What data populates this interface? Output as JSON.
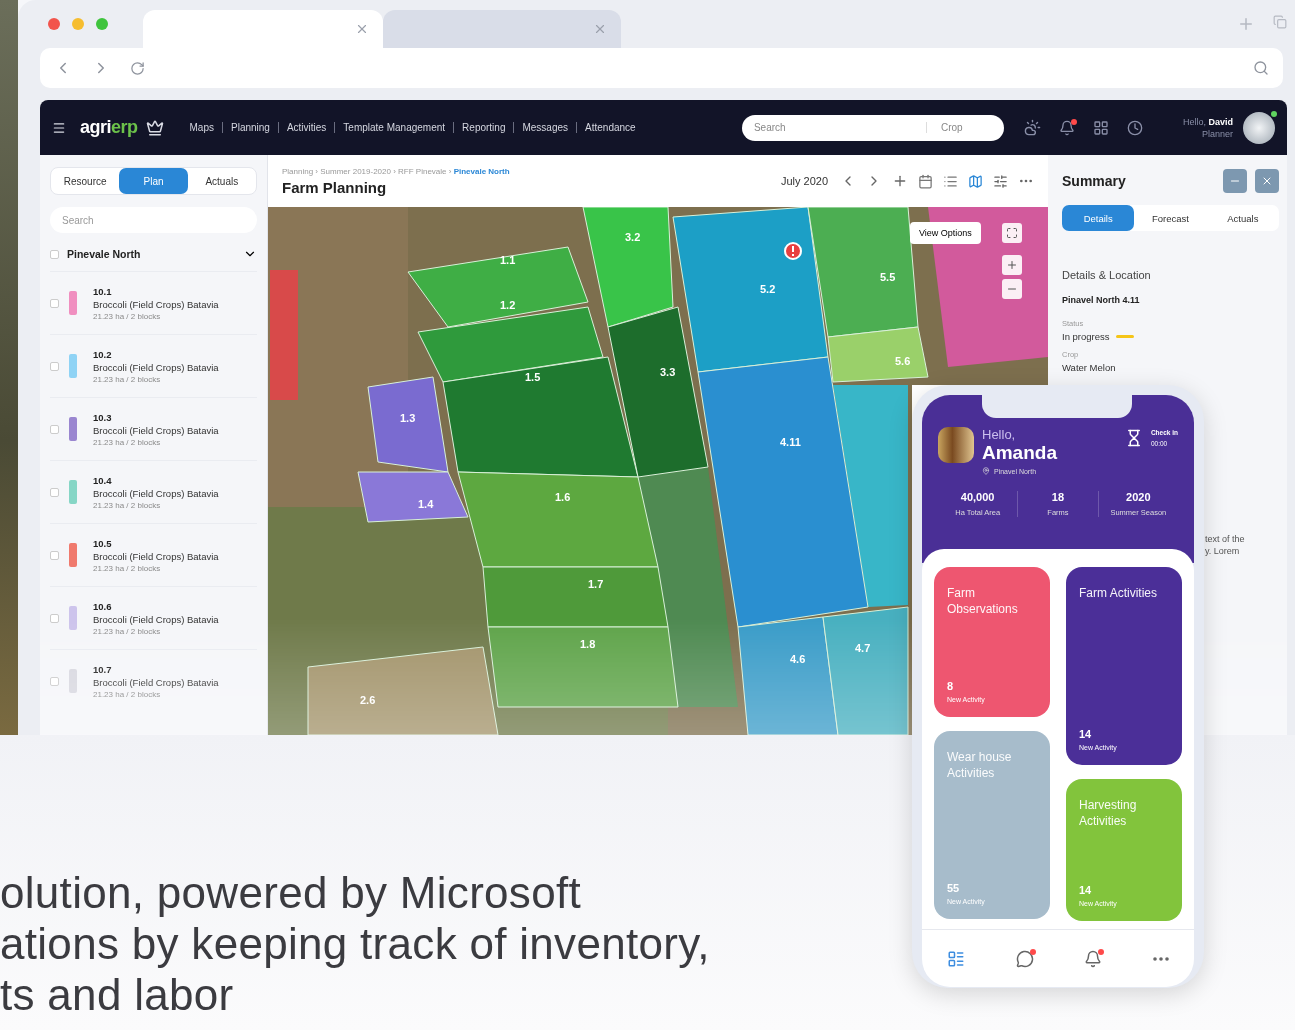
{
  "browser": {
    "tabs": [
      {
        "selected": true
      },
      {
        "selected": false
      }
    ]
  },
  "app": {
    "logo": {
      "part_1": "agri",
      "part_2": "erp"
    },
    "menu": [
      "Maps",
      "Planning",
      "Activities",
      "Template Management",
      "Reporting",
      "Messages",
      "Attendance"
    ],
    "search": {
      "placeholder": "Search",
      "filter": "Crop"
    },
    "notifications": {
      "badge": true
    },
    "user": {
      "greeting": "Hello,",
      "name": "David",
      "role": "Planner",
      "online": true
    },
    "sidebar": {
      "modes": [
        {
          "label": "Resource",
          "selected": false
        },
        {
          "label": "Plan",
          "selected": true
        },
        {
          "label": "Actuals",
          "selected": false
        }
      ],
      "search": {
        "placeholder": "Search"
      },
      "group": {
        "title": "Pinevale North",
        "checked": false,
        "expanded": true
      },
      "items": [
        {
          "id": "10.1",
          "name": "Broccoli (Field Crops) Batavia",
          "meta": "21.23 ha / 2 blocks",
          "color": "#f08fc0",
          "checked": false
        },
        {
          "id": "10.2",
          "name": "Broccoli (Field Crops) Batavia",
          "meta": "21.23 ha / 2 blocks",
          "color": "#8fd3f5",
          "checked": false
        },
        {
          "id": "10.3",
          "name": "Broccoli (Field Crops) Batavia",
          "meta": "21.23 ha / 2 blocks",
          "color": "#9a86d0",
          "checked": false
        },
        {
          "id": "10.4",
          "name": "Broccoli (Field Crops) Batavia",
          "meta": "21.23 ha / 2 blocks",
          "color": "#86d6c6",
          "checked": false
        },
        {
          "id": "10.5",
          "name": "Broccoli (Field Crops) Batavia",
          "meta": "21.23 ha / 2 blocks",
          "color": "#f07a6e",
          "checked": false
        },
        {
          "id": "10.6",
          "name": "Broccoli (Field Crops) Batavia",
          "meta": "21.23 ha / 2 blocks",
          "color": "#cdc4ec",
          "checked": false
        },
        {
          "id": "10.7",
          "name": "Broccoli (Field Crops) Batavia",
          "meta": "21.23 ha / 2 blocks",
          "color": "#d8d8e0",
          "checked": false
        }
      ]
    },
    "main": {
      "breadcrumb": "Planning › Summer 2019-2020 › RFF Pinevale › **Pinevale North**",
      "title": "Farm Planning",
      "period": "July 2020",
      "views": [
        {
          "kind": "calendar",
          "selected": false
        },
        {
          "kind": "list",
          "selected": false
        },
        {
          "kind": "map",
          "selected": true
        }
      ],
      "map": {
        "view_options": "View Options",
        "fields": [
          {
            "label": "1.1"
          },
          {
            "label": "1.2"
          },
          {
            "label": "1.5"
          },
          {
            "label": "1.3"
          },
          {
            "label": "1.4"
          },
          {
            "label": "1.6"
          },
          {
            "label": "1.7"
          },
          {
            "label": "1.8"
          },
          {
            "label": "3.2"
          },
          {
            "label": "3.3"
          },
          {
            "label": "5.2"
          },
          {
            "label": "4.11"
          },
          {
            "label": "4.6"
          },
          {
            "label": "4.7"
          },
          {
            "label": "5.5"
          },
          {
            "label": "5.6"
          },
          {
            "label": "2.6"
          }
        ]
      }
    },
    "summary": {
      "title": "Summary",
      "tabs": [
        {
          "label": "Details",
          "selected": true
        },
        {
          "label": "Forecast",
          "selected": false
        },
        {
          "label": "Actuals",
          "selected": false
        }
      ],
      "section": "Details & Location",
      "field_name": "Pinavel North 4.11",
      "status_label": "Status",
      "status": {
        "label": "In progress",
        "kind": "in_progress"
      },
      "crop_label": "Crop",
      "crop": "Water Melon",
      "note": [
        "text of the",
        "y. Lorem"
      ]
    }
  },
  "phone": {
    "greeting": "Hello,",
    "name": "Amanda",
    "location": "Pinavel North",
    "check_in": {
      "label": "Check in",
      "time": "00:00"
    },
    "stats": [
      {
        "value": "40,000",
        "label": "Ha Total Area"
      },
      {
        "value": "18",
        "label": "Farms"
      },
      {
        "value": "2020",
        "label": "Summer Season"
      }
    ],
    "columns": [
      [
        {
          "title": "Farm Observations",
          "count": "8",
          "sub": "New Activity",
          "color": "#ee5670"
        },
        {
          "title": "Wear house Activities",
          "count": "55",
          "sub": "New Activity",
          "color": "#a7bccb"
        }
      ],
      [
        {
          "title": "Farm Activities",
          "count": "14",
          "sub": "New Activity",
          "color": "#4b2f98"
        },
        {
          "title": "Harvesting Activities",
          "count": "14",
          "sub": "New Activity",
          "color": "#82c43c"
        }
      ]
    ],
    "nav": [
      {
        "kind": "home",
        "selected": true,
        "badge": false
      },
      {
        "kind": "chat",
        "selected": false,
        "badge": true
      },
      {
        "kind": "bell",
        "selected": false,
        "badge": true
      },
      {
        "kind": "more",
        "selected": false,
        "badge": false
      }
    ]
  },
  "headline": [
    "olution, powered by Microsoft",
    "ations by keeping track of inventory,",
    "ts and labor"
  ]
}
